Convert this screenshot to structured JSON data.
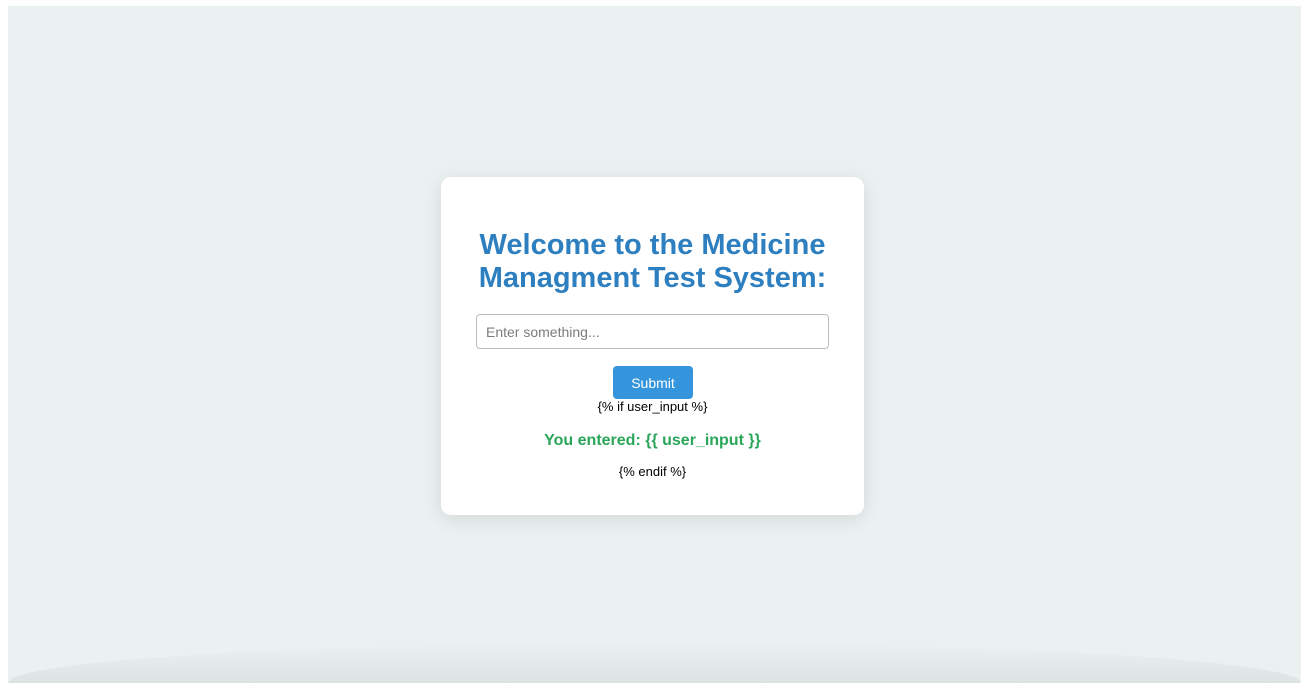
{
  "page": {
    "title_line1": "Welcome to the Medicine",
    "title_line2": "Managment Test System:"
  },
  "form": {
    "input_placeholder": "Enter something...",
    "input_value": "",
    "submit_label": "Submit"
  },
  "template": {
    "if_line": "{% if user_input %}",
    "result_text": "You entered: {{ user_input }}",
    "endif_line": "{% endif %}"
  },
  "colors": {
    "background": "#ebf0f0",
    "title": "#2e7fbf",
    "button": "#3595dc",
    "result": "#2aa65a"
  }
}
